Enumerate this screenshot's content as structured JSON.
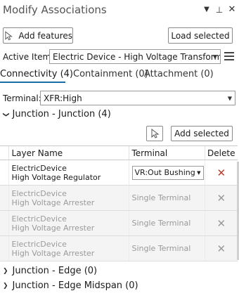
{
  "pane": {
    "title": "Modify Associations"
  },
  "toolbar": {
    "add_features_label": "Add features",
    "load_selected_label": "Load selected"
  },
  "active_item": {
    "label": "Active Item:",
    "value": "Electric Device - High Voltage Transformer"
  },
  "tabs": [
    {
      "label": "Connectivity (4)",
      "active": true
    },
    {
      "label": "Containment (0)",
      "active": false
    },
    {
      "label": "Attachment (0)",
      "active": false
    }
  ],
  "terminal": {
    "label": "Terminal:",
    "value": "XFR:High"
  },
  "groups": {
    "junction_junction": "Junction - Junction (4)",
    "junction_edge": "Junction - Edge (0)",
    "junction_edge_midspan": "Junction - Edge Midspan (0)"
  },
  "add_selected_label": "Add selected",
  "table": {
    "headers": {
      "layer_name": "Layer Name",
      "terminal": "Terminal",
      "delete": "Delete"
    },
    "rows": [
      {
        "layer": "ElectricDevice",
        "name": "High Voltage Regulator",
        "terminal": "VR:Out Bushing",
        "enabled": true
      },
      {
        "layer": "ElectricDevice",
        "name": "High Voltage Arrester",
        "terminal": "Single Terminal",
        "enabled": false
      },
      {
        "layer": "ElectricDevice",
        "name": "High Voltage Arrester",
        "terminal": "Single Terminal",
        "enabled": false
      },
      {
        "layer": "ElectricDevice",
        "name": "High Voltage Arrester",
        "terminal": "Single Terminal",
        "enabled": false
      }
    ]
  },
  "colors": {
    "tab_underline": "#1a6ea8",
    "delete_active": "#c0392b",
    "delete_disabled": "#e0a79f"
  }
}
